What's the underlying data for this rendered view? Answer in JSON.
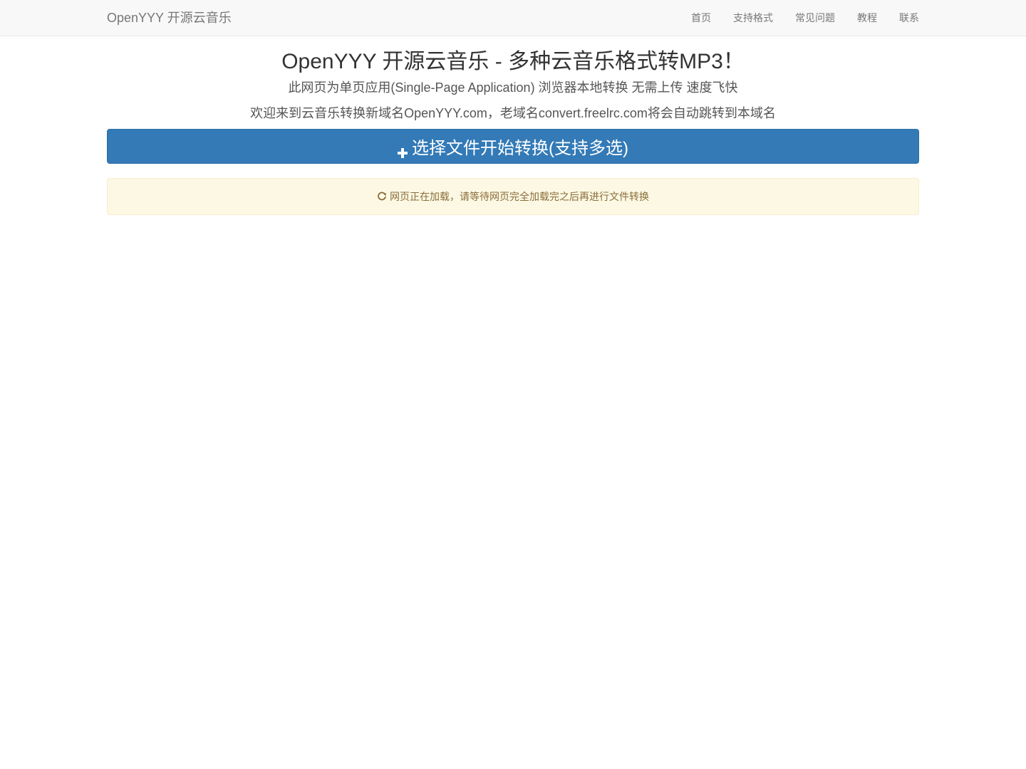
{
  "navbar": {
    "brand": "OpenYYY 开源云音乐",
    "links": [
      {
        "label": "首页"
      },
      {
        "label": "支持格式"
      },
      {
        "label": "常见问题"
      },
      {
        "label": "教程"
      },
      {
        "label": "联系"
      }
    ]
  },
  "main": {
    "title": "OpenYYY 开源云音乐 - 多种云音乐格式转MP3！",
    "subtitle": "此网页为单页应用(Single-Page Application) 浏览器本地转换 无需上传 速度飞快",
    "notice": "欢迎来到云音乐转换新域名OpenYYY.com，老域名convert.freelrc.com将会自动跳转到本域名",
    "convert_button": {
      "icon": "plus-icon",
      "label": "选择文件开始转换(支持多选)"
    },
    "loading_alert": {
      "icon": "refresh-icon",
      "text": "网页正在加载，请等待网页完全加载完之后再进行文件转换"
    }
  },
  "colors": {
    "navbar_bg": "#f8f8f8",
    "primary": "#337ab7",
    "alert_bg": "#fcf8e3",
    "alert_text": "#8a6d3b"
  }
}
